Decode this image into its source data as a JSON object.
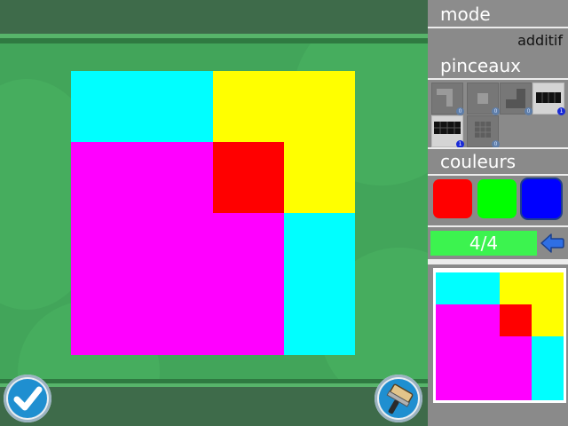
{
  "panel": {
    "mode_label": "mode",
    "mode_value": "additif",
    "brushes_label": "pinceaux",
    "colors_label": "couleurs",
    "progress": "4/4"
  },
  "brushes": [
    {
      "name": "corner",
      "badge": "0",
      "selected": false
    },
    {
      "name": "small-square",
      "badge": "0",
      "selected": false
    },
    {
      "name": "l-shape",
      "badge": "0",
      "selected": false
    },
    {
      "name": "horizontal-bar",
      "badge": "1",
      "selected": true
    },
    {
      "name": "wide-bar",
      "badge": "1",
      "selected": true
    },
    {
      "name": "grid-square",
      "badge": "0",
      "selected": false
    }
  ],
  "colors": [
    {
      "name": "red",
      "hex": "#ff0000",
      "selected": false
    },
    {
      "name": "green",
      "hex": "#00ff00",
      "selected": false
    },
    {
      "name": "blue",
      "hex": "#0000ff",
      "selected": true
    }
  ],
  "canvas_grid": {
    "size": 4,
    "cells": [
      [
        "#00ffff",
        "#00ffff",
        "#ffff00",
        "#ffff00"
      ],
      [
        "#ff00ff",
        "#ff00ff",
        "#ff0000",
        "#ffff00"
      ],
      [
        "#ff00ff",
        "#ff00ff",
        "#ff00ff",
        "#00ffff"
      ],
      [
        "#ff00ff",
        "#ff00ff",
        "#ff00ff",
        "#00ffff"
      ]
    ]
  },
  "target_grid": {
    "size": 4,
    "cells": [
      [
        "#00ffff",
        "#00ffff",
        "#ffff00",
        "#ffff00"
      ],
      [
        "#ff00ff",
        "#ff00ff",
        "#ff0000",
        "#ffff00"
      ],
      [
        "#ff00ff",
        "#ff00ff",
        "#ff00ff",
        "#00ffff"
      ],
      [
        "#ff00ff",
        "#ff00ff",
        "#ff00ff",
        "#00ffff"
      ]
    ]
  },
  "buttons": {
    "validate_icon": "checkmark-icon",
    "brush_icon": "paint-brush-icon",
    "undo_icon": "back-arrow-icon"
  }
}
